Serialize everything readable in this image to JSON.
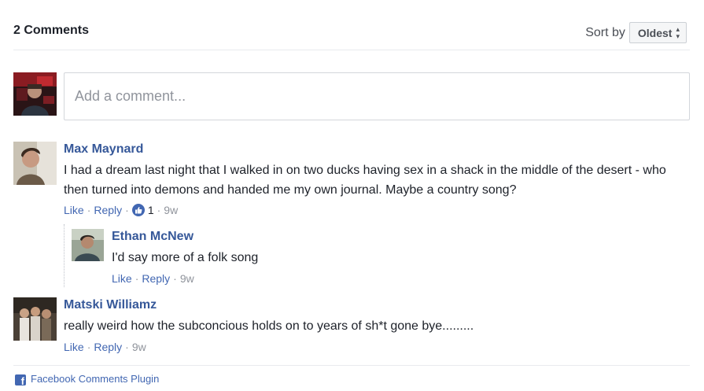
{
  "header": {
    "count_label": "2 Comments",
    "sort_label": "Sort by",
    "sort_selected": "Oldest"
  },
  "composer": {
    "placeholder": "Add a comment..."
  },
  "comments": [
    {
      "author": "Max Maynard",
      "text": "I had a dream last night that I walked in on two ducks having sex in a shack in the middle of the desert - who then turned into demons and handed me my own journal. Maybe a country song?",
      "like_label": "Like",
      "reply_label": "Reply",
      "like_count": "1",
      "time": "9w",
      "replies": [
        {
          "author": "Ethan McNew",
          "text": "I'd say more of a folk song",
          "like_label": "Like",
          "reply_label": "Reply",
          "time": "9w"
        }
      ]
    },
    {
      "author": "Matski Williamz",
      "text": "really weird how the subconcious holds on to years of sh*t gone bye.........",
      "like_label": "Like",
      "reply_label": "Reply",
      "time": "9w"
    }
  ],
  "footer": {
    "plugin_label": "Facebook Comments Plugin"
  },
  "colors": {
    "link": "#4267b2",
    "author": "#365899",
    "muted": "#90949c",
    "text": "#1d2129"
  }
}
